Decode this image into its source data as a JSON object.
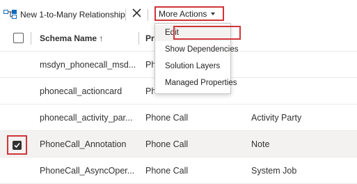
{
  "toolbar": {
    "new_relationship_label": "New 1-to-Many Relationship",
    "more_actions_label": "More Actions",
    "delete_icon": "close-x-icon",
    "relationship_icon": "relationship-diagram-icon"
  },
  "grid": {
    "columns": {
      "schema_name": "Schema Name ↑",
      "primary_entity": "Pr"
    },
    "rows": [
      {
        "schema_name": "msdyn_phonecall_msd...",
        "primary_entity": "Phon",
        "related_entity": "",
        "selected": false
      },
      {
        "schema_name": "phonecall_actioncard",
        "primary_entity": "Ph",
        "related_entity": "",
        "selected": false
      },
      {
        "schema_name": "phonecall_activity_par...",
        "primary_entity": "Phone Call",
        "related_entity": "Activity Party",
        "selected": false
      },
      {
        "schema_name": "PhoneCall_Annotation",
        "primary_entity": "Phone Call",
        "related_entity": "Note",
        "selected": true
      },
      {
        "schema_name": "PhoneCall_AsyncOper...",
        "primary_entity": "Phone Call",
        "related_entity": "System Job",
        "selected": false
      }
    ]
  },
  "menu": {
    "items": [
      "Edit",
      "Show Dependencies",
      "Solution Layers",
      "Managed Properties"
    ]
  },
  "colors": {
    "highlight_red": "#d13438",
    "selected_row": "#f3f2f1",
    "text": "#323130"
  }
}
